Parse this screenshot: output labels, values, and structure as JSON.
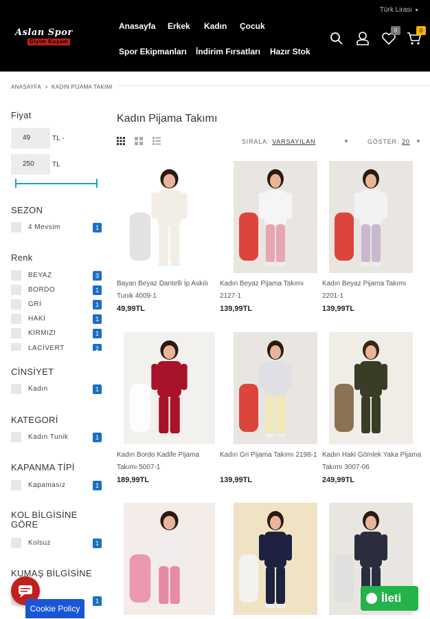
{
  "header": {
    "currency": "Türk Lirası",
    "logo_top": "Aslan Spor",
    "logo_bottom": "Giyim Kuşam",
    "nav": [
      "Anasayfa",
      "Erkek",
      "Kadın",
      "Çocuk",
      "Spor Ekipmanları",
      "İndirim Fırsatları",
      "Hazır Stok"
    ],
    "wishlist_count": "0",
    "cart_count": "0"
  },
  "breadcrumb": {
    "home": "ANASAYFA",
    "separator": ">",
    "current": "KADIN PİJAMA TAKIMI"
  },
  "filters": {
    "price": {
      "title": "Fiyat",
      "min": "49",
      "max": "250",
      "unit_min": "TL -",
      "unit_max": "TL",
      "range_fraction": [
        0.0,
        1.0
      ]
    },
    "season": {
      "title": "SEZON",
      "items": [
        {
          "label": "4 Mevsim",
          "count": "1"
        }
      ]
    },
    "color": {
      "title": "Renk",
      "items": [
        {
          "label": "BEYAZ",
          "count": "3"
        },
        {
          "label": "BORDO",
          "count": "1"
        },
        {
          "label": "GRİ",
          "count": "1"
        },
        {
          "label": "HAKİ",
          "count": "1"
        },
        {
          "label": "KIRMIZI",
          "count": "1"
        },
        {
          "label": "LACİVERT",
          "count": "2"
        }
      ]
    },
    "gender": {
      "title": "CİNSİYET",
      "items": [
        {
          "label": "Kadın",
          "count": "1"
        }
      ]
    },
    "category": {
      "title": "KATEGORİ",
      "items": [
        {
          "label": "Kadın Tunik",
          "count": "1"
        }
      ]
    },
    "closure": {
      "title": "KAPANMA TİPİ",
      "items": [
        {
          "label": "Kapamasız",
          "count": "1"
        }
      ]
    },
    "sleeve": {
      "title": "KOL BİLGİSİNE GÖRE",
      "items": [
        {
          "label": "Kolsuz",
          "count": "1"
        }
      ]
    },
    "fabric": {
      "title": "KUMAŞ BİLGİSİNE",
      "items": [
        {
          "label": "",
          "count": "1"
        }
      ]
    }
  },
  "main": {
    "title": "Kadın Pijama Takımı",
    "sort_label": "SIRALA:",
    "sort_value": "VARSAYILAN",
    "show_label": "GÖSTER:",
    "show_value": "20"
  },
  "products": [
    {
      "name": "Bayan Beyaz Dantelli İp Askılı Tunik 4009-1",
      "price": "49,99TL",
      "colors": {
        "bg": "#ffffff",
        "top": "#f2eee6",
        "bottom": "#f2eee6",
        "hair": "#2a1a12",
        "skin": "#e8b59a",
        "accent": "#dddddd"
      }
    },
    {
      "name": "Kadın Beyaz Pijama Takımı 2127-1",
      "price": "139,99TL",
      "colors": {
        "bg": "#e9e6e1",
        "top": "#f5f5f5",
        "bottom": "#e8a5b2",
        "hair": "#2a1a12",
        "skin": "#e8b59a",
        "accent": "#d8281e"
      }
    },
    {
      "name": "Kadın Beyaz Pijama Takımı 2201-1",
      "price": "139,99TL",
      "colors": {
        "bg": "#e9e6e1",
        "top": "#f2f2f2",
        "bottom": "#c9b8cf",
        "hair": "#2a1a12",
        "skin": "#e8b59a",
        "accent": "#d8281e"
      }
    },
    {
      "name": "Kadın Bordo Kadife Pijama Takımı 5007-1",
      "price": "189,99TL",
      "colors": {
        "bg": "#f3f1ee",
        "top": "#a8122a",
        "bottom": "#a8122a",
        "hair": "#2a1a12",
        "skin": "#e8b59a",
        "accent": "#ffffff"
      }
    },
    {
      "name": "Kadın Gri Pijama Takımı 2198-1",
      "price": "139,99TL",
      "colors": {
        "bg": "#e9e6e1",
        "top": "#dfe0e3",
        "bottom": "#f1e7b8",
        "hair": "#2a1a12",
        "skin": "#e8b59a",
        "accent": "#d8281e"
      }
    },
    {
      "name": "Kadın Haki Gömlek Yaka Pijama Takımı 3007-06",
      "price": "249,99TL",
      "colors": {
        "bg": "#f0ece6",
        "top": "#3a3d25",
        "bottom": "#3a3d25",
        "hair": "#3a2414",
        "skin": "#e8b59a",
        "accent": "#7a5d3a"
      }
    },
    {
      "name": "",
      "price": "",
      "colors": {
        "bg": "#f4ece8",
        "top": "#f1ecec",
        "bottom": "#e68aa6",
        "hair": "#2a1a12",
        "skin": "#e8b59a",
        "accent": "#e68aa6"
      }
    },
    {
      "name": "",
      "price": "",
      "colors": {
        "bg": "#f0e3c4",
        "top": "#1c2240",
        "bottom": "#1c2240",
        "hair": "#2a1a12",
        "skin": "#e8b59a",
        "accent": "#f5f5f5"
      }
    },
    {
      "name": "",
      "price": "",
      "colors": {
        "bg": "#e9e6e1",
        "top": "#2a2d3d",
        "bottom": "#2a2d3d",
        "hair": "#2a1a12",
        "skin": "#e8b59a",
        "accent": "#dddddd"
      }
    }
  ],
  "floating": {
    "cookie_label": "Cookie Policy",
    "contact_label": "İleti"
  },
  "colors": {
    "header_bg": "#000000",
    "count_badge": "#1b6fc2",
    "slider": "#17a2b8",
    "cart_badge": "#f5b400",
    "cookie_button": "#1a55d6",
    "contact_button": "#24b24a",
    "chat_button": "#c0201e"
  }
}
